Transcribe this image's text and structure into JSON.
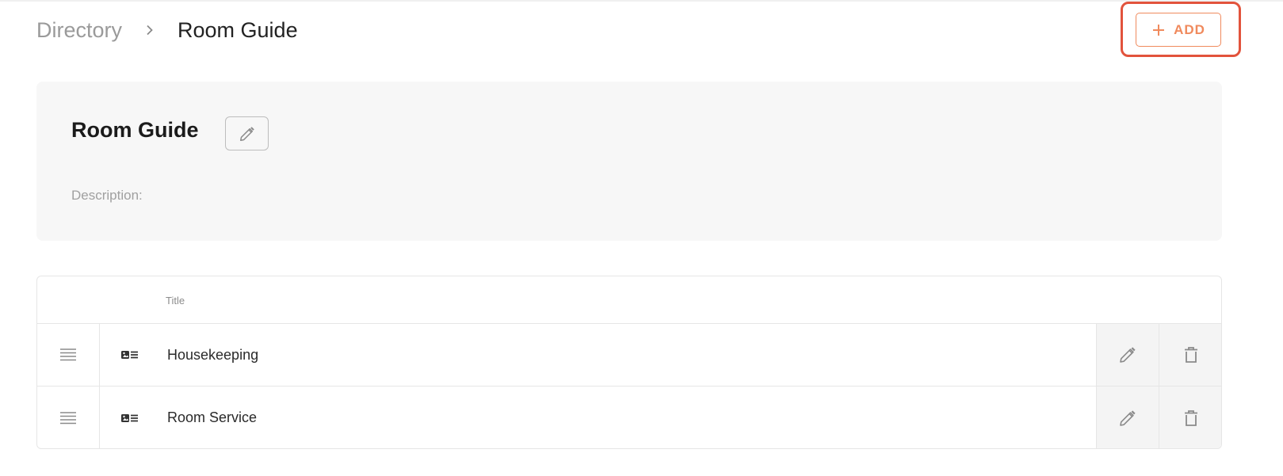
{
  "breadcrumb": {
    "parent": "Directory",
    "current": "Room Guide"
  },
  "header": {
    "add_label": "ADD",
    "add_icon": "plus-icon",
    "accent_color": "#f08a5d",
    "highlight_color": "#e2533c"
  },
  "guide": {
    "title": "Room Guide",
    "edit_icon": "pencil-icon",
    "description_label": "Description:"
  },
  "table": {
    "columns": {
      "title": "Title"
    },
    "rows": [
      {
        "title": "Housekeeping",
        "type_icon": "card-list-icon"
      },
      {
        "title": "Room Service",
        "type_icon": "card-list-icon"
      }
    ]
  }
}
